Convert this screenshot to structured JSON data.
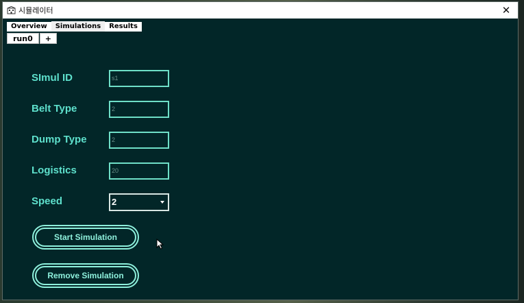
{
  "window": {
    "title": "시뮬레이터",
    "app_icon": "building-icon",
    "close_label": "✕"
  },
  "tabs": [
    {
      "label": "Overview",
      "active": false
    },
    {
      "label": "Simulations",
      "active": true
    },
    {
      "label": "Results",
      "active": false
    }
  ],
  "subtabs": {
    "run_label": "run0",
    "add_label": "+"
  },
  "form": {
    "simul_id": {
      "label": "SImul ID",
      "value": "s1"
    },
    "belt_type": {
      "label": "Belt Type",
      "value": "2"
    },
    "dump_type": {
      "label": "Dump Type",
      "value": "2"
    },
    "logistics": {
      "label": "Logistics",
      "value": "20"
    },
    "speed": {
      "label": "Speed",
      "value": "2"
    }
  },
  "buttons": {
    "start": "Start Simulation",
    "remove": "Remove Simulation"
  },
  "colors": {
    "window_bg": "#022628",
    "accent": "#5ee0cc",
    "button_border": "#8ef0dc"
  }
}
